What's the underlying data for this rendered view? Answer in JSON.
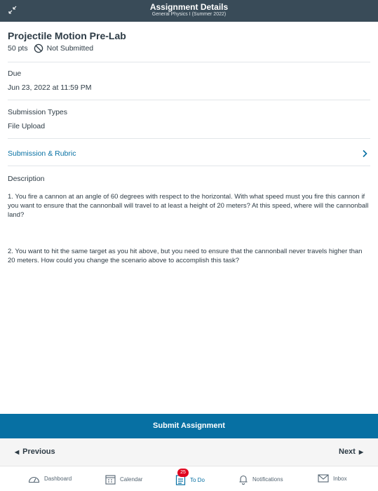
{
  "header": {
    "title": "Assignment Details",
    "subtitle": "General Physics I (Summer 2022)",
    "expand_icon": "expand-arrows-icon"
  },
  "assignment": {
    "title": "Projectile Motion Pre-Lab",
    "points": "50 pts",
    "status": "Not Submitted",
    "status_icon": "not-allowed-icon"
  },
  "due": {
    "label": "Due",
    "value": "Jun 23, 2022 at 11:59 PM"
  },
  "submission_types": {
    "label": "Submission Types",
    "value": "File Upload"
  },
  "rubric": {
    "label": "Submission & Rubric",
    "icon": "chevron-right-icon"
  },
  "description": {
    "label": "Description",
    "paragraphs": [
      "1. You fire a cannon at an angle of 60 degrees with respect to the horizontal.  With what speed must you fire this cannon if you want to ensure that the cannonball will travel to at least a height of 20 meters?  At this speed, where will the cannonball land?",
      "2. You want to hit the same target as you hit above, but you need to ensure that the cannonball never travels higher than 20 meters.  How could you change the scenario above to accomplish this task?"
    ]
  },
  "actions": {
    "submit": "Submit Assignment",
    "previous": "Previous",
    "next": "Next"
  },
  "tabbar": {
    "items": [
      {
        "label": "Dashboard",
        "icon": "dashboard-icon"
      },
      {
        "label": "Calendar",
        "icon": "calendar-icon"
      },
      {
        "label": "To Do",
        "icon": "todo-icon",
        "badge": "25",
        "active": true
      },
      {
        "label": "Notifications",
        "icon": "bell-icon"
      },
      {
        "label": "Inbox",
        "icon": "mail-icon"
      }
    ]
  },
  "colors": {
    "header_bg": "#394b58",
    "accent": "#0770a3",
    "badge": "#e0061f"
  }
}
